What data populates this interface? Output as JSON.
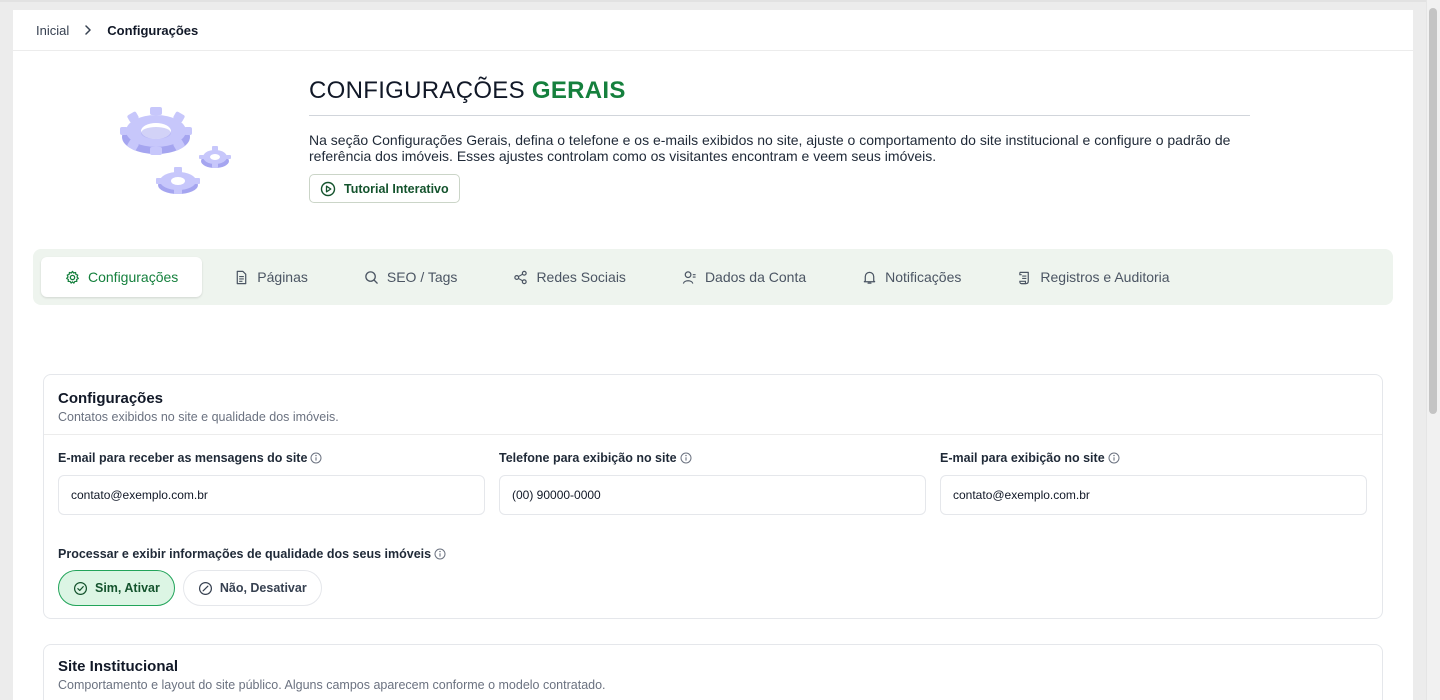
{
  "breadcrumb": {
    "home": "Inicial",
    "current": "Configurações"
  },
  "hero": {
    "title_main": "CONFIGURAÇÕES",
    "title_accent": "GERAIS",
    "description": "Na seção Configurações Gerais, defina o telefone e os e-mails exibidos no site, ajuste o comportamento do site institucional e configure o padrão de referência dos imóveis. Esses ajustes controlam como os visitantes encontram e veem seus imóveis.",
    "tutorial_label": "Tutorial Interativo",
    "illustration_icon": "gears-illustration"
  },
  "tabs": [
    {
      "label": "Configurações",
      "icon": "gear-icon",
      "active": true
    },
    {
      "label": "Páginas",
      "icon": "document-icon",
      "active": false
    },
    {
      "label": "SEO / Tags",
      "icon": "search-icon",
      "active": false
    },
    {
      "label": "Redes Sociais",
      "icon": "share-icon",
      "active": false
    },
    {
      "label": "Dados da Conta",
      "icon": "user-icon",
      "active": false
    },
    {
      "label": "Notificações",
      "icon": "bell-icon",
      "active": false
    },
    {
      "label": "Registros e Auditoria",
      "icon": "scroll-icon",
      "active": false
    }
  ],
  "settings_card": {
    "title": "Configurações",
    "subtitle": "Contatos exibidos no site e qualidade dos imóveis.",
    "fields": [
      {
        "label": "E-mail para receber as mensagens do site",
        "value": "contato@exemplo.com.br"
      },
      {
        "label": "Telefone para exibição no site",
        "value": "(00) 90000-0000"
      },
      {
        "label": "E-mail para exibição no site",
        "value": "contato@exemplo.com.br"
      }
    ],
    "quality_label": "Processar e exibir informações de qualidade dos seus imóveis",
    "enable_label": "Sim, Ativar",
    "disable_label": "Não, Desativar",
    "quality_enabled": true
  },
  "institutional_card": {
    "title": "Site Institucional",
    "subtitle": "Comportamento e layout do site público. Alguns campos aparecem conforme o modelo contratado."
  },
  "colors": {
    "accent": "#15803d",
    "tab_bar_bg": "#eef4ee",
    "choice_on_bg": "#dcf5e4",
    "choice_on_border": "#22a45a"
  }
}
